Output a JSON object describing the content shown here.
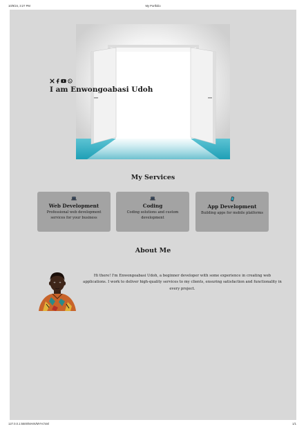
{
  "print": {
    "datetime": "10/9/24, 3:27 PM",
    "doc_title": "My Portfolio",
    "file_path": "127.0.0.1:5500/MAIN/MYH.html",
    "page_count": "1/1"
  },
  "hero": {
    "title": "I am Enwongoabasi Udoh",
    "social_icons": [
      "x-icon",
      "facebook-icon",
      "youtube-icon",
      "whatsapp-icon"
    ]
  },
  "services": {
    "title": "My Services",
    "items": [
      {
        "icon": "laptop-icon",
        "name": "Web Development",
        "desc": "Professional web development services for your business"
      },
      {
        "icon": "laptop-icon",
        "name": "Coding",
        "desc": "Coding solutions and custom development"
      },
      {
        "icon": "mobile-icon",
        "name": "App Development",
        "desc": "Building apps for mobile platforms"
      }
    ]
  },
  "about": {
    "title": "About Me",
    "text": "Hi there! I'm Enwongoabasi Udoh, a beginner developer with some experience in creating web applications. I work to deliver high-quality services to my clients, ensuring satisfaction and functionality in every project."
  },
  "colors": {
    "page_bg": "#d8d8d8",
    "card_bg": "#a3a3a3",
    "floor_teal": "#2fb0c6"
  }
}
